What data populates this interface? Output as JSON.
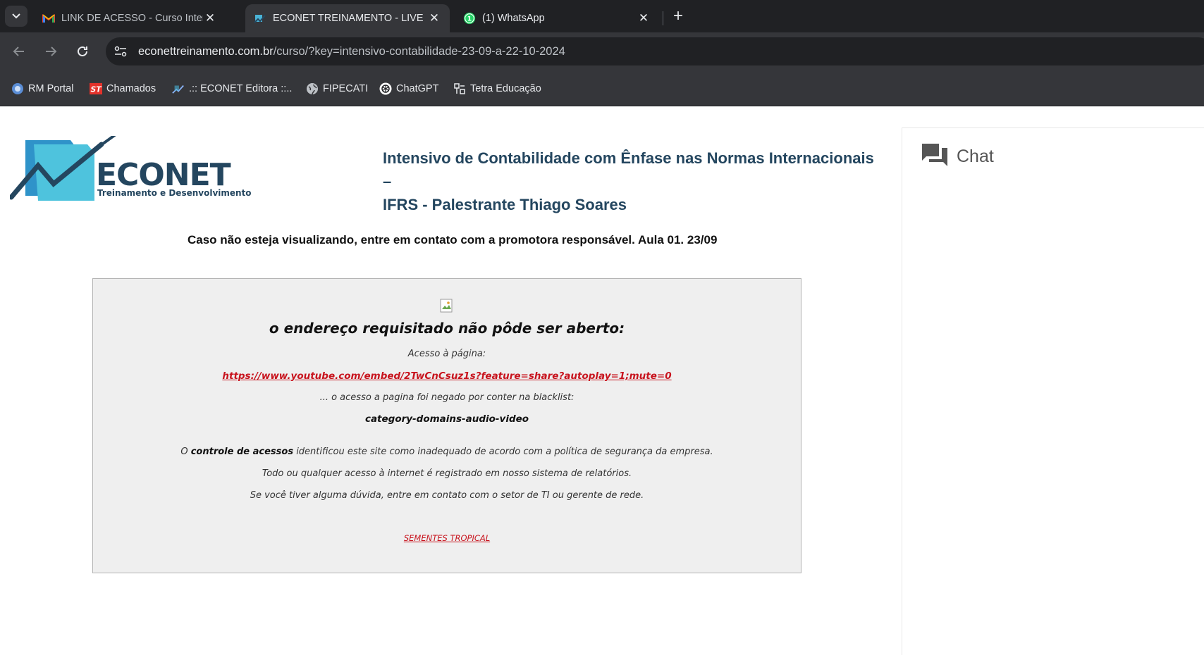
{
  "tabs": [
    {
      "title": "LINK DE ACESSO - Curso Intensivo",
      "favicon": "gmail-icon",
      "active": false
    },
    {
      "title": "ECONET TREINAMENTO - LIVE",
      "favicon": "econet-icon",
      "active": true
    },
    {
      "title": "(1) WhatsApp",
      "favicon": "whatsapp-icon",
      "active": false,
      "badge": "1"
    }
  ],
  "toolbar": {
    "url_host": "econettreinamento.com.br",
    "url_path": "/curso/?key=intensivo-contabilidade-23-09-a-22-10-2024"
  },
  "bookmarks": [
    {
      "label": "RM Portal",
      "icon": "rm-portal-icon"
    },
    {
      "label": "Chamados",
      "icon": "st-icon"
    },
    {
      "label": ".:: ECONET Editora ::..",
      "icon": "econet-editora-icon"
    },
    {
      "label": "FIPECATI",
      "icon": "globe-icon"
    },
    {
      "label": "ChatGPT",
      "icon": "chatgpt-icon"
    },
    {
      "label": "Tetra Educação",
      "icon": "tetra-icon"
    }
  ],
  "page": {
    "logo_text": "ECONET",
    "logo_tagline": "Treinamento e Desenvolvimento",
    "course_title_line1": "Intensivo de Contabilidade com Ênfase nas Normas Internacionais –",
    "course_title_line2": "IFRS - Palestrante Thiago Soares",
    "notice": "Caso não esteja visualizando, entre em contato com a promotora responsável. Aula 01. 23/09",
    "blocked": {
      "title": "o endereço requisitado não pôde ser aberto:",
      "access_label": "Acesso à página:",
      "url": "https://www.youtube.com/embed/2TwCnCsuz1s?feature=share?autoplay=1;mute=0",
      "denied_text": "... o acesso a pagina foi negado por conter na blacklist:",
      "category": "category-domains-audio-video",
      "policy_prefix": "O ",
      "policy_bold": "controle de acessos",
      "policy_suffix": " identificou este site como inadequado de acordo com a política de segurança da empresa.",
      "registry_text": "Todo ou qualquer acesso à internet é registrado em nosso sistema de relatórios.",
      "contact_text": "Se você tiver alguma dúvida, entre em contato com o setor de TI ou gerente de rede.",
      "footer_link": "SEMENTES TROPICAL"
    },
    "chat_label": "Chat"
  },
  "colors": {
    "chrome_dark": "#202124",
    "chrome_toolbar": "#35363a",
    "title_blue": "#24465f",
    "link_red": "#c8141e",
    "block_bg": "#efefef"
  }
}
